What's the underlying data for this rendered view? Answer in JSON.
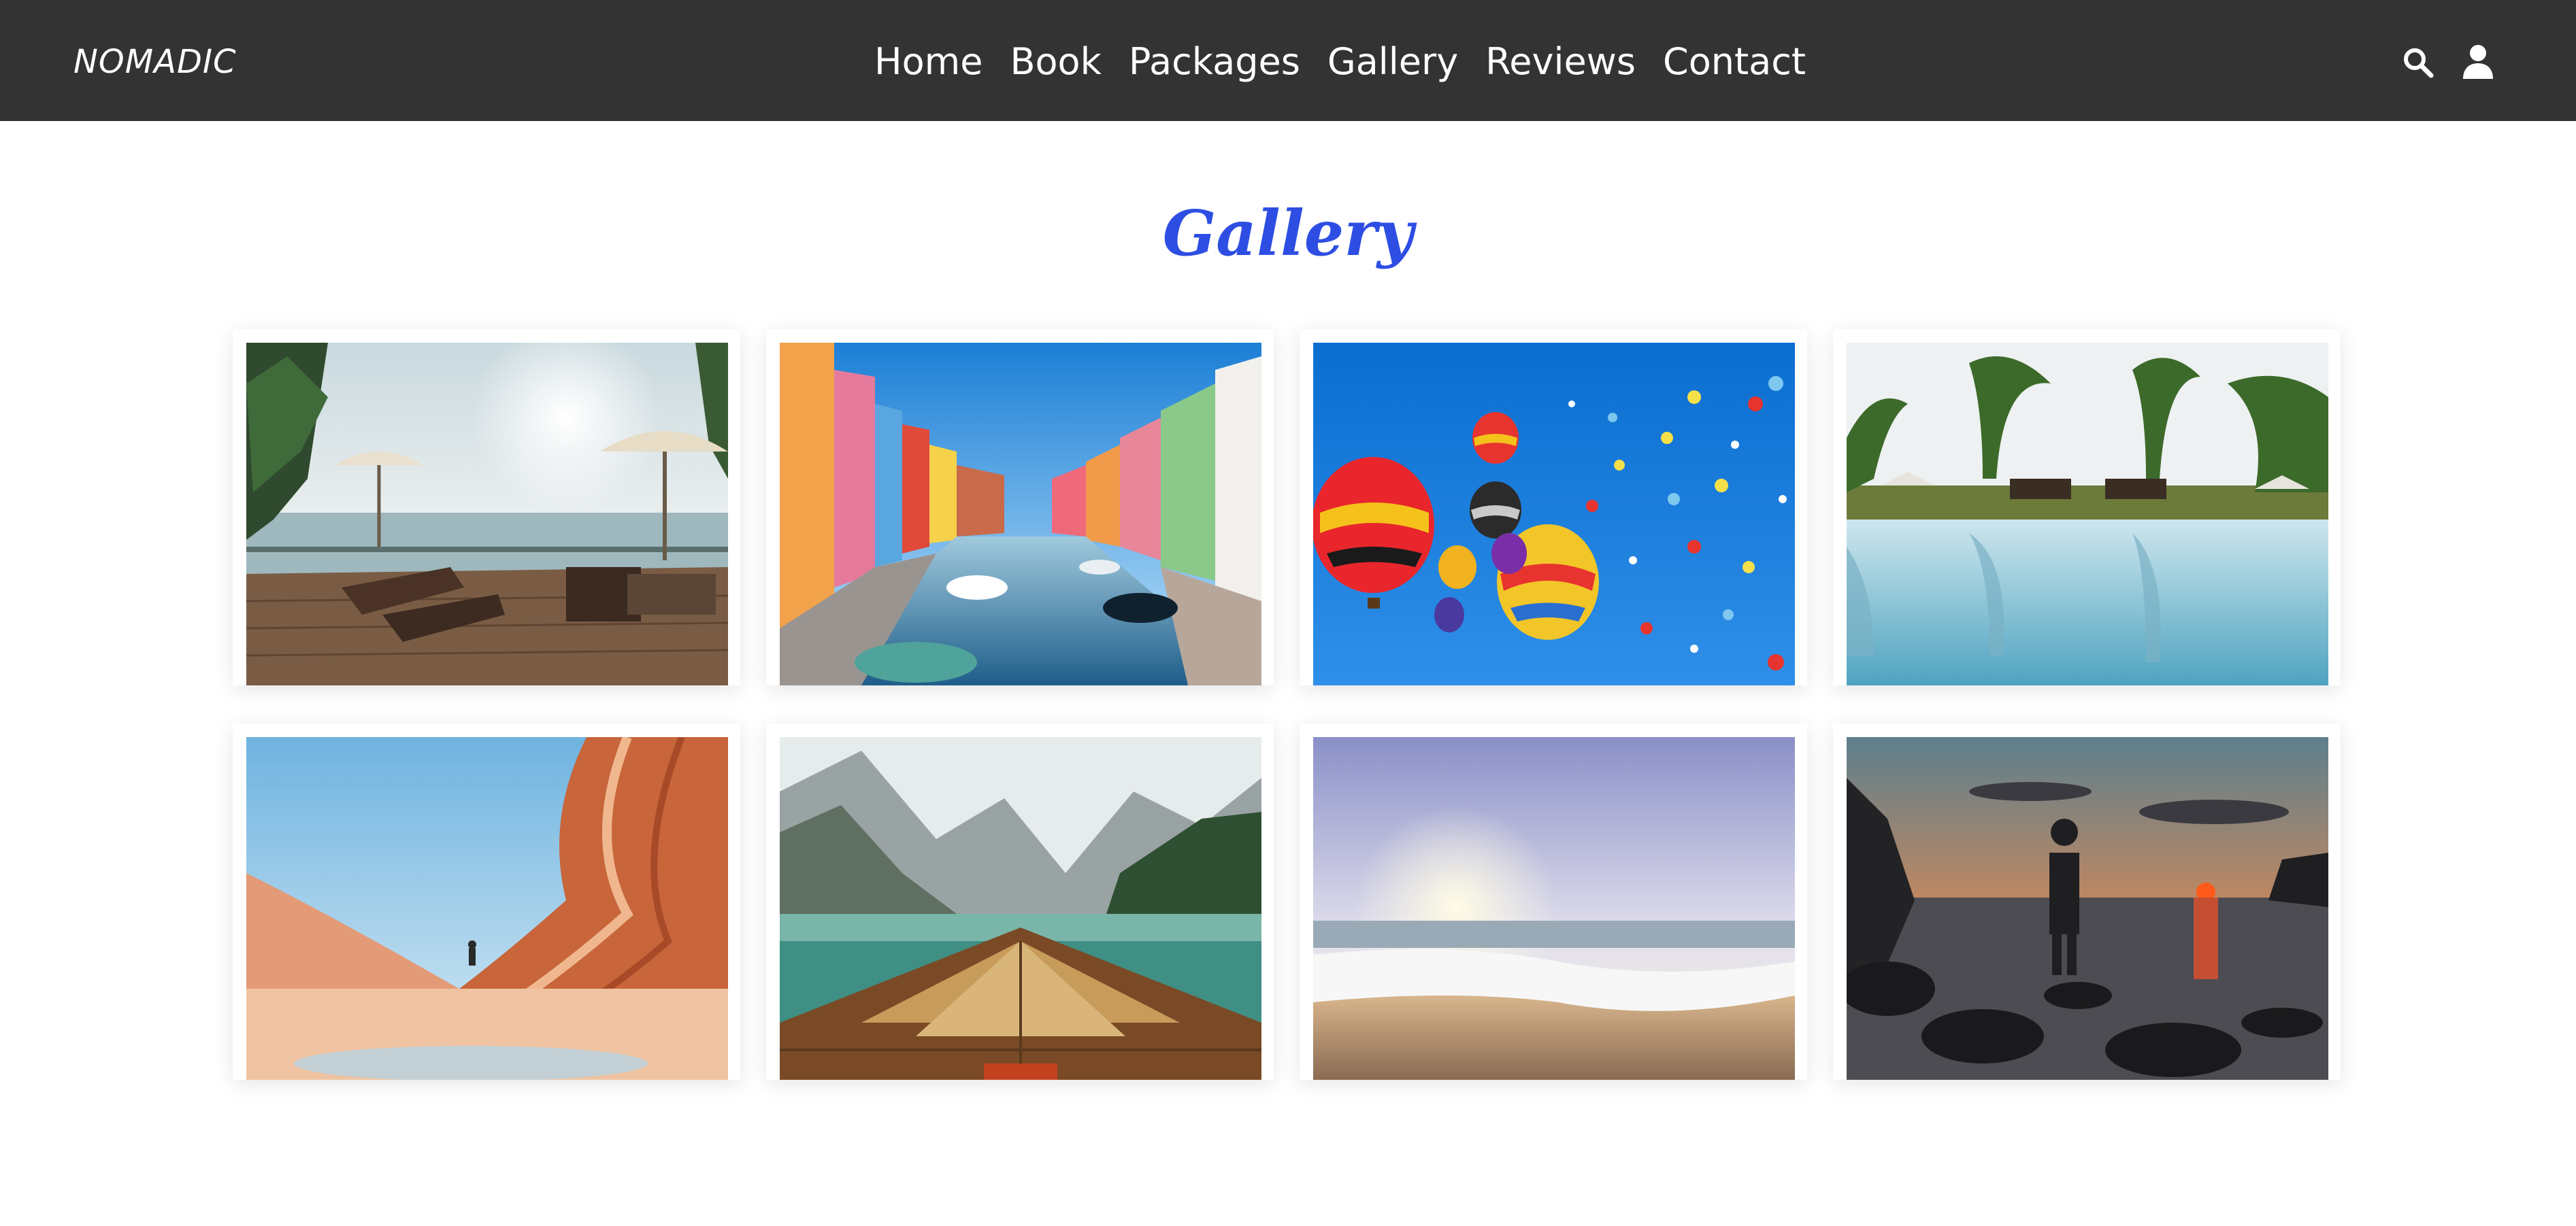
{
  "brand": {
    "logo": "NOMADIC"
  },
  "nav": {
    "items": [
      {
        "label": "Home"
      },
      {
        "label": "Book"
      },
      {
        "label": "Packages"
      },
      {
        "label": "Gallery"
      },
      {
        "label": "Reviews"
      },
      {
        "label": "Contact"
      }
    ],
    "icons": [
      "search-icon",
      "user-icon"
    ]
  },
  "gallery": {
    "title": "Gallery",
    "images": [
      {
        "name": "gallery-image-infinity-pool-deck"
      },
      {
        "name": "gallery-image-colorful-canal"
      },
      {
        "name": "gallery-image-hot-air-balloons"
      },
      {
        "name": "gallery-image-palm-resort-pool"
      },
      {
        "name": "gallery-image-sandstone-canyon"
      },
      {
        "name": "gallery-image-mountain-lake-boat"
      },
      {
        "name": "gallery-image-beach-sunrise"
      },
      {
        "name": "gallery-image-sunset-rocks"
      }
    ]
  },
  "colors": {
    "navbar": "#333333",
    "title_accent": "#2e4ee3",
    "background": "#ffffff"
  }
}
